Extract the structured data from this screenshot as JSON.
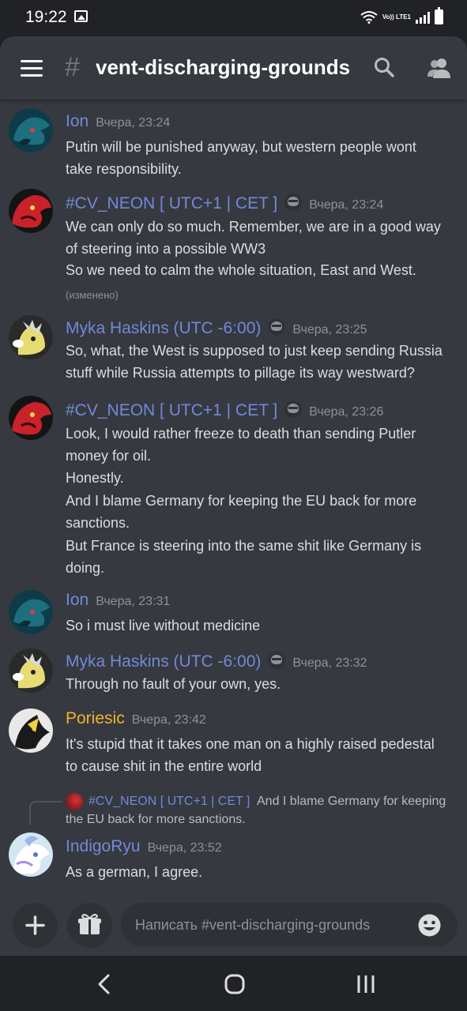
{
  "status_bar": {
    "time": "19:22",
    "network": "Vo)) LTE1"
  },
  "header": {
    "menu_icon": "hamburger-menu-icon",
    "channel_prefix": "#",
    "channel_name": "vent-discharging-grounds",
    "search_icon": "search-icon",
    "members_icon": "members-icon"
  },
  "colors": {
    "blurple_author": "#7289da",
    "gold_author": "#f0b232",
    "background": "#36393f",
    "timestamp": "#8e9297"
  },
  "messages": [
    {
      "author": "Ion",
      "author_color": "#7289da",
      "badge": false,
      "timestamp": "Вчера, 23:24",
      "lines": [
        "Putin will be punished anyway, but western people wont",
        "take responsibility."
      ],
      "edited": ""
    },
    {
      "author": "#CV_NEON [ UTC+1 | CET ]",
      "author_color": "#7289da",
      "badge": true,
      "timestamp": "Вчера, 23:24",
      "lines": [
        "We can only do so much. Remember, we are in a good way",
        "of steering into a possible WW3",
        "So we need to calm the whole situation, East and West."
      ],
      "edited": "(изменено)"
    },
    {
      "author": "Myka Haskins (UTC -6:00)",
      "author_color": "#7289da",
      "badge": true,
      "timestamp": "Вчера, 23:25",
      "lines": [
        "So, what, the West is supposed to just keep sending Russia",
        "stuff while Russia attempts to pillage its way westward?"
      ],
      "edited": ""
    },
    {
      "author": "#CV_NEON [ UTC+1 | CET ]",
      "author_color": "#7289da",
      "badge": true,
      "timestamp": "Вчера, 23:26",
      "lines": [
        "Look, I would rather freeze to death than sending Putler",
        "money for oil.",
        "Honestly.",
        "And I blame Germany for keeping the EU back for more",
        "sanctions.",
        "But France is steering into the same shit like Germany is",
        "doing."
      ],
      "edited": ""
    },
    {
      "author": "Ion",
      "author_color": "#7289da",
      "badge": false,
      "timestamp": "Вчера, 23:31",
      "lines": [
        "So i must live without medicine"
      ],
      "edited": ""
    },
    {
      "author": "Myka Haskins (UTC -6:00)",
      "author_color": "#7289da",
      "badge": true,
      "timestamp": "Вчера, 23:32",
      "lines": [
        "Through no fault of your own, yes."
      ],
      "edited": ""
    },
    {
      "author": "Poriesic",
      "author_color": "#f0b232",
      "badge": false,
      "timestamp": "Вчера, 23:42",
      "lines": [
        "It's stupid that it takes one man on a highly raised pedestal",
        "to cause shit in the entire world"
      ],
      "edited": ""
    },
    {
      "author": "IndigoRyu",
      "author_color": "#7289da",
      "badge": false,
      "timestamp": "Вчера, 23:52",
      "lines": [
        "As a german, I agree."
      ],
      "edited": "",
      "reply": {
        "author": "#CV_NEON [ UTC+1 | CET ]",
        "text_line1": "And I blame Germany for keeping",
        "text_line2": "the EU back for more sanctions."
      }
    }
  ],
  "input": {
    "add_icon": "plus-icon",
    "gift_icon": "gift-icon",
    "placeholder": "Написать #vent-discharging-grounds",
    "emoji_icon": "emoji-icon"
  },
  "nav_bar": {
    "back_icon": "back-icon",
    "home_icon": "home-icon",
    "recents_icon": "recents-icon"
  }
}
